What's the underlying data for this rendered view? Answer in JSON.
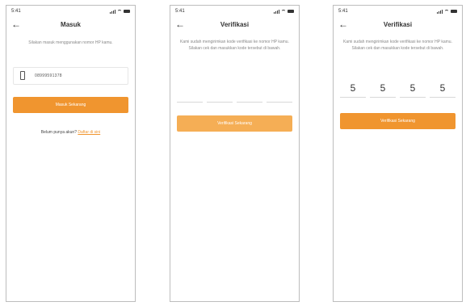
{
  "screens": [
    {
      "status_time": "5:41",
      "title": "Masuk",
      "description": "Silakan masuk menggunakan nomor HP kamu.",
      "phone_value": "08999591378",
      "button_label": "Masuk Sekarang",
      "signup_prompt": "Belum punya akun?",
      "signup_link": "Daftar di sini"
    },
    {
      "status_time": "5:41",
      "title": "Verifikasi",
      "description": "Kami sudah mengirimkan kode verifikasi ke nomor HP kamu. Silakan cek dan masukkan kode tersebut di bawah.",
      "otp_digits": [
        "",
        "",
        "",
        ""
      ],
      "button_label": "Verifikasi Sekarang"
    },
    {
      "status_time": "5:41",
      "title": "Verifikasi",
      "description": "Kami sudah mengirimkan kode verifikasi ke nomor HP kamu. Silakan cek dan masukkan kode tersebut di bawah.",
      "otp_digits": [
        "5",
        "5",
        "5",
        "5"
      ],
      "button_label": "Verifikasi Sekarang"
    }
  ],
  "colors": {
    "accent": "#f0952f",
    "accent_light": "#f5ae55"
  },
  "icons": [
    "back-arrow-icon",
    "signal-icon",
    "wifi-icon",
    "battery-icon",
    "phone-icon"
  ]
}
